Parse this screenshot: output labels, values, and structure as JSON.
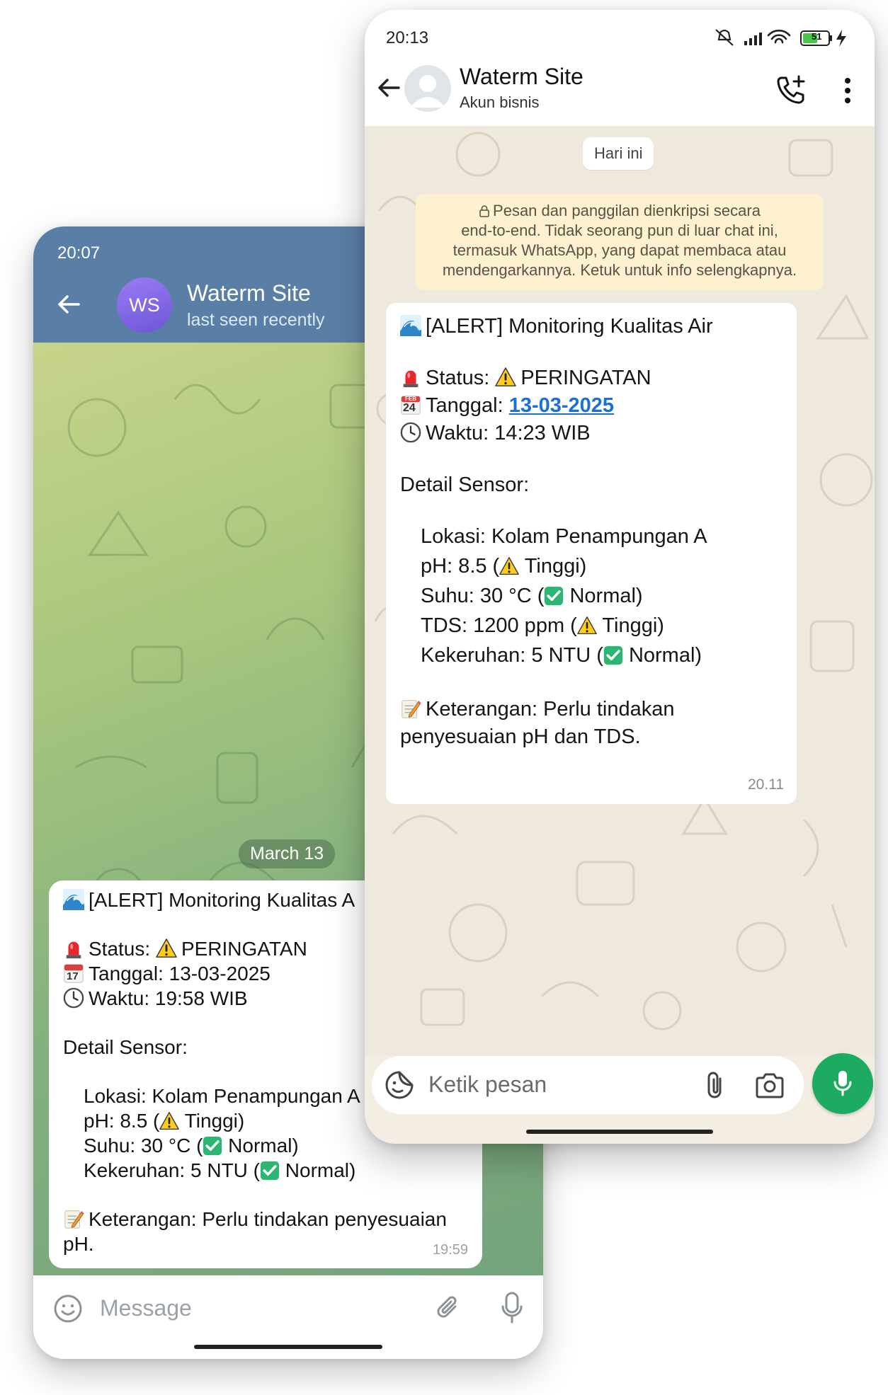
{
  "telegram": {
    "status_time": "20:07",
    "avatar_initials": "WS",
    "contact_name": "Waterm Site",
    "contact_status": "last seen recently",
    "date_chip": "March 13",
    "message": {
      "title": "[ALERT] Monitoring Kualitas A",
      "status": "Status: ",
      "status_value": "PERINGATAN",
      "date": "Tanggal: 13-03-2025",
      "calendar_day": "17",
      "time": "Waktu: 19:58 WIB",
      "detail_heading": "Detail Sensor:",
      "location": "Lokasi: Kolam Penampungan A",
      "ph_prefix": "pH: 8.5 (",
      "ph_suffix": " Tinggi)",
      "temp_prefix": "Suhu: 30 °C (",
      "temp_suffix": " Normal)",
      "turbidity_prefix": "Kekeruhan: 5 NTU (",
      "turbidity_suffix": " Normal)",
      "note_line1": "Keterangan: Perlu tindakan penyesuaian",
      "note_line2": "pH.",
      "timestamp": "19:59"
    },
    "input_placeholder": "Message",
    "colors": {
      "header": "#5a7fa6",
      "avatar": "#7b62e0"
    }
  },
  "whatsapp": {
    "status_time": "20:13",
    "battery": "51",
    "contact_name": "Waterm Site",
    "contact_subtitle": "Akun bisnis",
    "date_chip": "Hari ini",
    "encryption_notice": {
      "line1": "Pesan dan panggilan dienkripsi secara",
      "line2": "end-to-end. Tidak seorang pun di luar chat ini,",
      "line3": "termasuk WhatsApp, yang dapat membaca atau",
      "line4": "mendengarkannya. Ketuk untuk info selengkapnya."
    },
    "message": {
      "title": "[ALERT] Monitoring Kualitas Air",
      "status": "Status: ",
      "status_value": "PERINGATAN",
      "date_label": "Tanggal: ",
      "date_link": "13-03-2025",
      "calendar_month": "FEB",
      "calendar_day": "24",
      "time": "Waktu: 14:23 WIB",
      "detail_heading": "Detail Sensor:",
      "location": "Lokasi: Kolam Penampungan A",
      "ph_prefix": "pH: 8.5 (",
      "ph_suffix": " Tinggi)",
      "temp_prefix": "Suhu: 30 °C (",
      "temp_suffix": " Normal)",
      "tds_prefix": "TDS: 1200 ppm (",
      "tds_suffix": " Tinggi)",
      "turbidity_prefix": "Kekeruhan: 5 NTU (",
      "turbidity_suffix": " Normal)",
      "note_line1": "Keterangan: Perlu tindakan",
      "note_line2": "penyesuaian pH dan TDS.",
      "timestamp": "20.11"
    },
    "input_placeholder": "Ketik pesan",
    "colors": {
      "accent": "#1daa61",
      "link": "#1b6fd6",
      "encryption_bg": "#fdf1cf"
    }
  },
  "icons": [
    "wave-icon",
    "siren-icon",
    "warning-icon",
    "calendar-icon",
    "clock-icon",
    "check-icon",
    "memo-icon",
    "back-arrow-icon",
    "call-add-icon",
    "more-icon",
    "sticker-icon",
    "attach-icon",
    "camera-icon",
    "mic-icon",
    "emoji-icon",
    "lock-icon"
  ]
}
